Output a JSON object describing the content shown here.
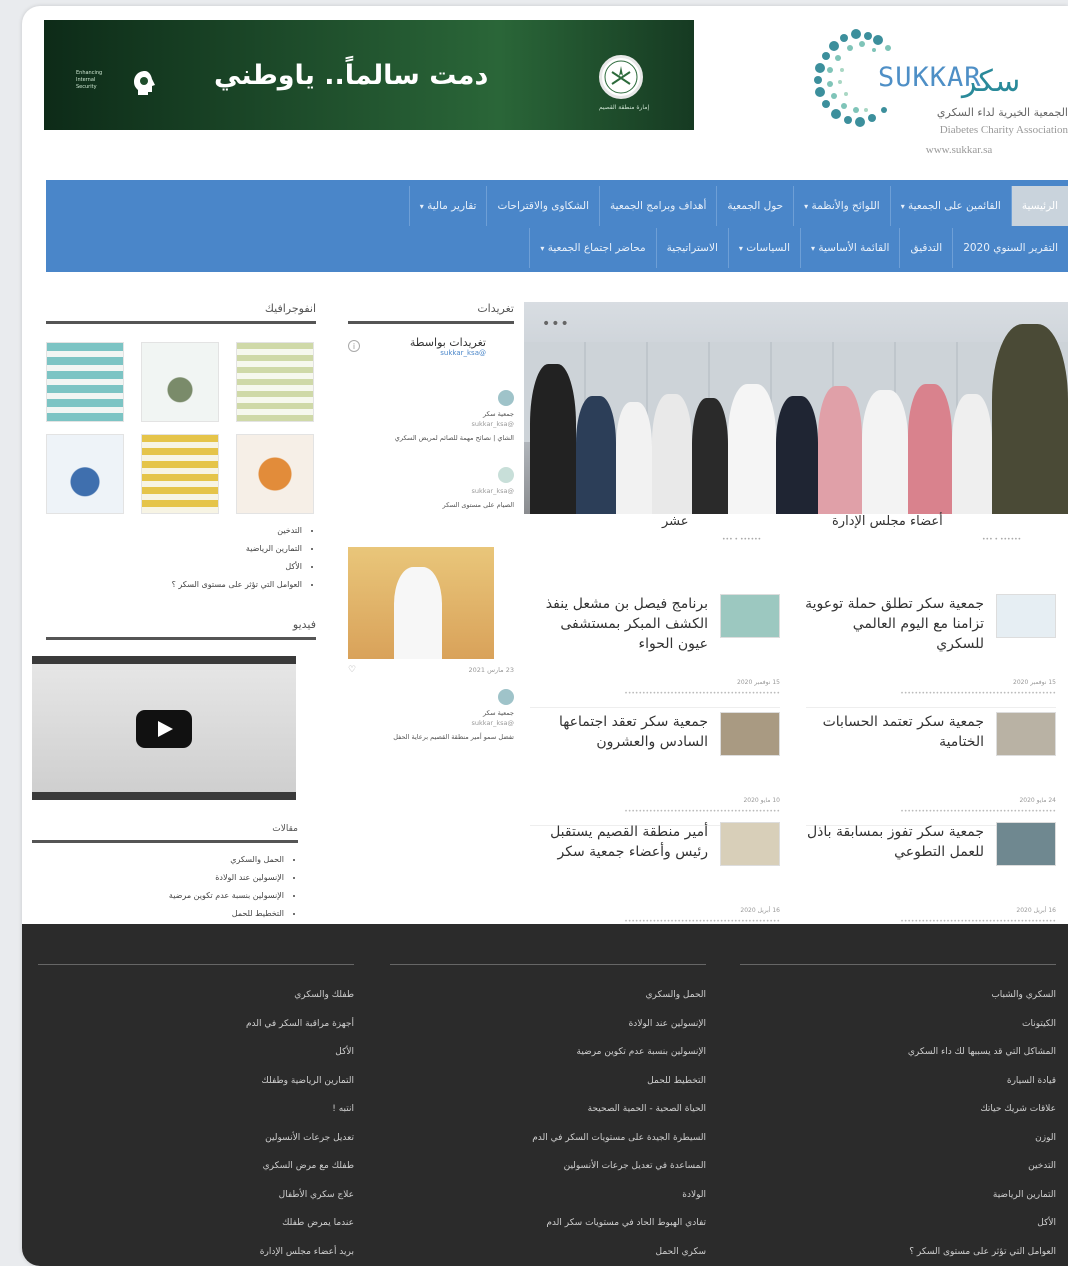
{
  "banner": {
    "slogan": "دمت سالماً.. ياوطني",
    "emblem_caption": "إمارة منطقة القصيم",
    "mini_text": "Enhancing Internal Security"
  },
  "logo": {
    "arabic_name": "سكر",
    "latin_name": "SUKKAR",
    "association_ar": "الجمعية الخيرية لداء السكري",
    "association_en": "Diabetes Charity Association",
    "website": "www.sukkar.sa"
  },
  "nav": {
    "row1": [
      {
        "label": "الرئيسية",
        "active": true,
        "caret": false
      },
      {
        "label": "القائمين على الجمعية",
        "active": false,
        "caret": true
      },
      {
        "label": "اللوائح والأنظمة",
        "active": false,
        "caret": true
      },
      {
        "label": "حول الجمعية",
        "active": false,
        "caret": false
      },
      {
        "label": "أهداف وبرامج الجمعية",
        "active": false,
        "caret": false
      },
      {
        "label": "الشكاوى والاقتراحات",
        "active": false,
        "caret": false
      },
      {
        "label": "تقارير مالية",
        "active": false,
        "caret": true
      }
    ],
    "row2": [
      {
        "label": "التقرير السنوي 2020",
        "caret": false
      },
      {
        "label": "التدقيق",
        "caret": false
      },
      {
        "label": "القائمة الأساسية",
        "caret": true
      },
      {
        "label": "السياسات",
        "caret": true
      },
      {
        "label": "الاستراتيجية",
        "caret": false
      },
      {
        "label": "محاضر اجتماع الجمعية",
        "caret": true
      }
    ]
  },
  "hero": {
    "dots": "•••",
    "caption_left": "عشر",
    "caption_right": "أعضاء مجلس الإدارة"
  },
  "news": [
    {
      "title": "جمعية سكر تطلق حملة توعوية تزامنا مع اليوم العالمي للسكري",
      "meta": "15 نوفمبر 2020"
    },
    {
      "title": "برنامج فيصل بن مشعل ينفذ الكشف المبكر بمستشفى عيون الحواء",
      "meta": "15 نوفمبر 2020"
    },
    {
      "title": "جمعية سكر تعتمد الحسابات الختامية",
      "meta": "24 مايو 2020"
    },
    {
      "title": "جمعية سكر تعقد اجتماعها السادس والعشرون",
      "meta": "10 مايو 2020"
    },
    {
      "title": "جمعية سكر تفوز بمسابقة باذل للعمل التطوعي",
      "meta": "16 أبريل 2020"
    },
    {
      "title": "أمير منطقة القصيم يستقبل رئيس وأعضاء جمعية سكر",
      "meta": "16 أبريل 2020"
    }
  ],
  "tweets": {
    "title": "تغريدات",
    "head_title": "تغريدات بواسطة",
    "head_handle": "@sukkar_ksa",
    "tweet1_name": "جمعية سكر",
    "tweet1_handle": "@sukkar_ksa",
    "tweet1_text": "الشاي | نصائح مهمة للصائم لمريض السكري",
    "tweet2_handle": "@sukkar_ksa",
    "tweet2_text": "الصيام على مستوى السكر",
    "photo_date": "23 مارس 2021",
    "tweet3_name": "جمعية سكر",
    "tweet3_handle": "@sukkar_ksa",
    "tweet3_text": "تفضل سمو أمير منطقة القصيم برعاية الحفل"
  },
  "infographics": {
    "title": "انفوجرافيك",
    "list": [
      "التدخين",
      "التمارين الرياضية",
      "الأكل",
      "العوامل التي تؤثر على مستوى السكر ؟"
    ],
    "video_title": "فيديو",
    "more_title": "مقالات",
    "more_list": [
      "الحمل والسكري",
      "الإنسولين عند الولادة",
      "الإنسولين بنسبة عدم تكوين مرضية",
      "التخطيط للحمل"
    ]
  },
  "footer": {
    "col_right": [
      "السكري والشباب",
      "الكيتونات",
      "المشاكل التي قد يسببها لك داء السكري",
      "قيادة السيارة",
      "علاقات شريك حياتك",
      "الوزن",
      "التدخين",
      "التمارين الرياضية",
      "الأكل",
      "العوامل التي تؤثر على مستوى السكر ؟"
    ],
    "col_middle": [
      "الحمل والسكري",
      "الإنسولين عند الولادة",
      "الإنسولين بنسبة عدم تكوين مرضية",
      "التخطيط للحمل",
      "الحياة الصحية - الحمية الصحيحة",
      "السيطرة الجيدة على مستويات السكر في الدم",
      "المساعدة في تعديل جرعات الأنسولين",
      "الولادة",
      "تفادي الهبوط الحاد في مستويات سكر الدم",
      "سكري الحمل"
    ],
    "col_left": [
      "طفلك والسكري",
      "أجهزة مراقبة السكر في الدم",
      "الأكل",
      "التمارين الرياضية وطفلك",
      "انتبه !",
      "تعديل جرعات الأنسولين",
      "طفلك مع مرض السكري",
      "علاج سكري الأطفال",
      "عندما يمرض طفلك",
      "بريد أعضاء مجلس الإدارة"
    ]
  }
}
